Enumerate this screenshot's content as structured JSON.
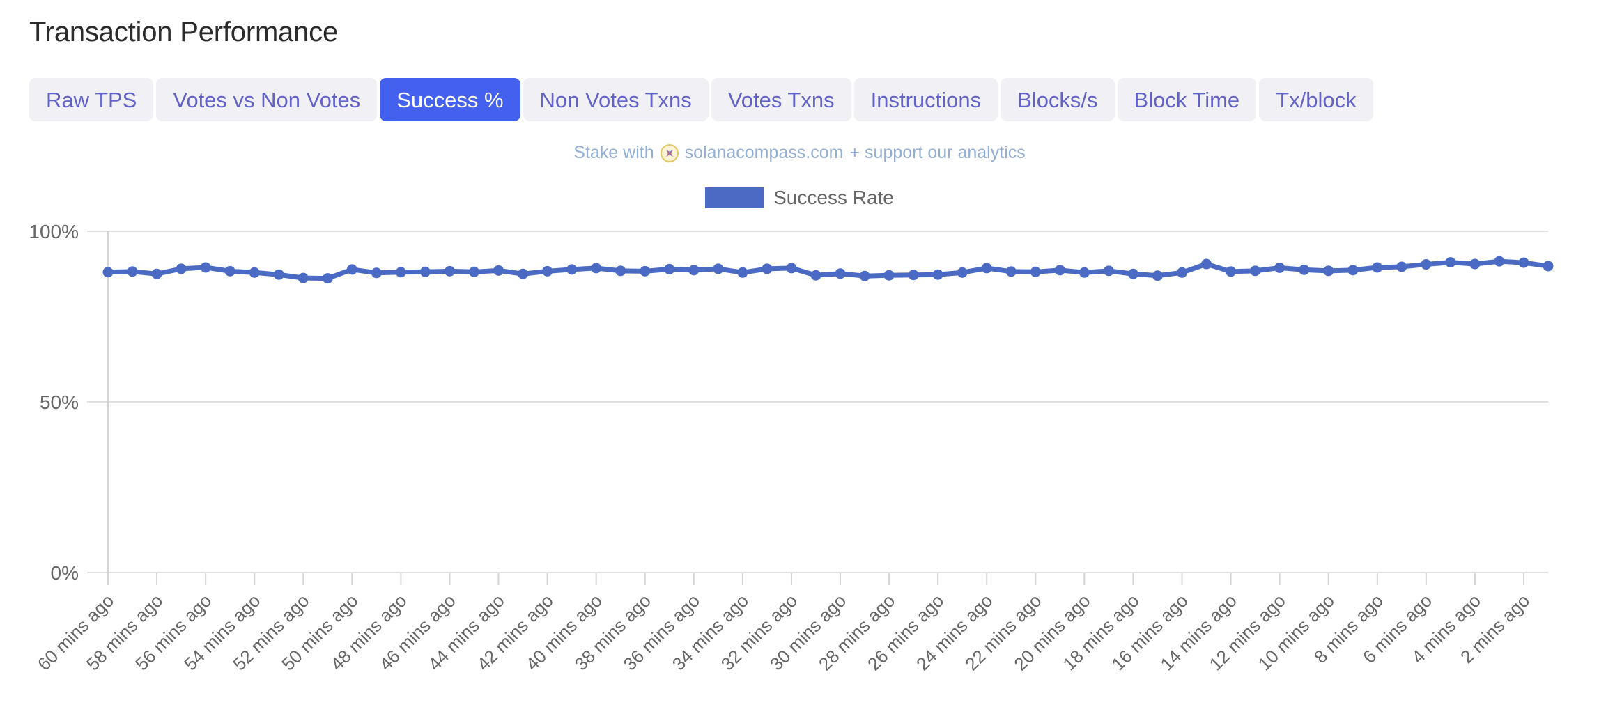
{
  "page_title": "Transaction Performance",
  "tabs": [
    {
      "label": "Raw TPS",
      "active": false
    },
    {
      "label": "Votes vs Non Votes",
      "active": false
    },
    {
      "label": "Success %",
      "active": true
    },
    {
      "label": "Non Votes Txns",
      "active": false
    },
    {
      "label": "Votes Txns",
      "active": false
    },
    {
      "label": "Instructions",
      "active": false
    },
    {
      "label": "Blocks/s",
      "active": false
    },
    {
      "label": "Block Time",
      "active": false
    },
    {
      "label": "Tx/block",
      "active": false
    }
  ],
  "promo": {
    "prefix": "Stake with",
    "icon": "compass-icon",
    "link": "solanacompass.com",
    "suffix": "+ support our analytics"
  },
  "legend": {
    "position": "top-center",
    "entries": [
      {
        "label": "Success Rate",
        "color": "#4a6ac4"
      }
    ]
  },
  "colors": {
    "accent": "#4361ee",
    "tab_bg": "#f1f1f5",
    "tab_text": "#6363c7",
    "series": "#4a6ac4",
    "grid": "#e0e0e0",
    "axis_text": "#666666",
    "promo_text": "#93aed4",
    "title_text": "#2b2b2b"
  },
  "chart_data": {
    "type": "line",
    "title": "",
    "xlabel": "",
    "ylabel": "",
    "ylim": [
      0,
      100
    ],
    "yticks": [
      0,
      50,
      100
    ],
    "ytick_labels": [
      "0%",
      "50%",
      "100%"
    ],
    "grid": true,
    "legend_position": "top-center",
    "tick_labels": [
      "60 mins ago",
      "58 mins ago",
      "56 mins ago",
      "54 mins ago",
      "52 mins ago",
      "50 mins ago",
      "48 mins ago",
      "46 mins ago",
      "44 mins ago",
      "42 mins ago",
      "40 mins ago",
      "38 mins ago",
      "36 mins ago",
      "34 mins ago",
      "32 mins ago",
      "30 mins ago",
      "28 mins ago",
      "26 mins ago",
      "24 mins ago",
      "22 mins ago",
      "20 mins ago",
      "18 mins ago",
      "16 mins ago",
      "14 mins ago",
      "12 mins ago",
      "10 mins ago",
      "8 mins ago",
      "6 mins ago",
      "4 mins ago",
      "2 mins ago"
    ],
    "series": [
      {
        "name": "Success Rate",
        "color": "#4a6ac4",
        "unit": "%",
        "values": [
          88.0,
          88.2,
          87.5,
          89.0,
          89.4,
          88.3,
          87.9,
          87.3,
          86.3,
          86.2,
          88.8,
          87.8,
          88.0,
          88.1,
          88.3,
          88.1,
          88.5,
          87.5,
          88.3,
          88.8,
          89.2,
          88.4,
          88.3,
          88.9,
          88.6,
          89.0,
          87.9,
          89.0,
          89.2,
          87.1,
          87.6,
          86.9,
          87.1,
          87.2,
          87.3,
          87.9,
          89.2,
          88.2,
          88.1,
          88.6,
          87.9,
          88.4,
          87.5,
          87.0,
          87.9,
          90.4,
          88.2,
          88.4,
          89.3,
          88.7,
          88.4,
          88.6,
          89.4,
          89.6,
          90.3,
          90.9,
          90.4,
          91.2,
          90.8,
          89.8
        ]
      }
    ]
  }
}
